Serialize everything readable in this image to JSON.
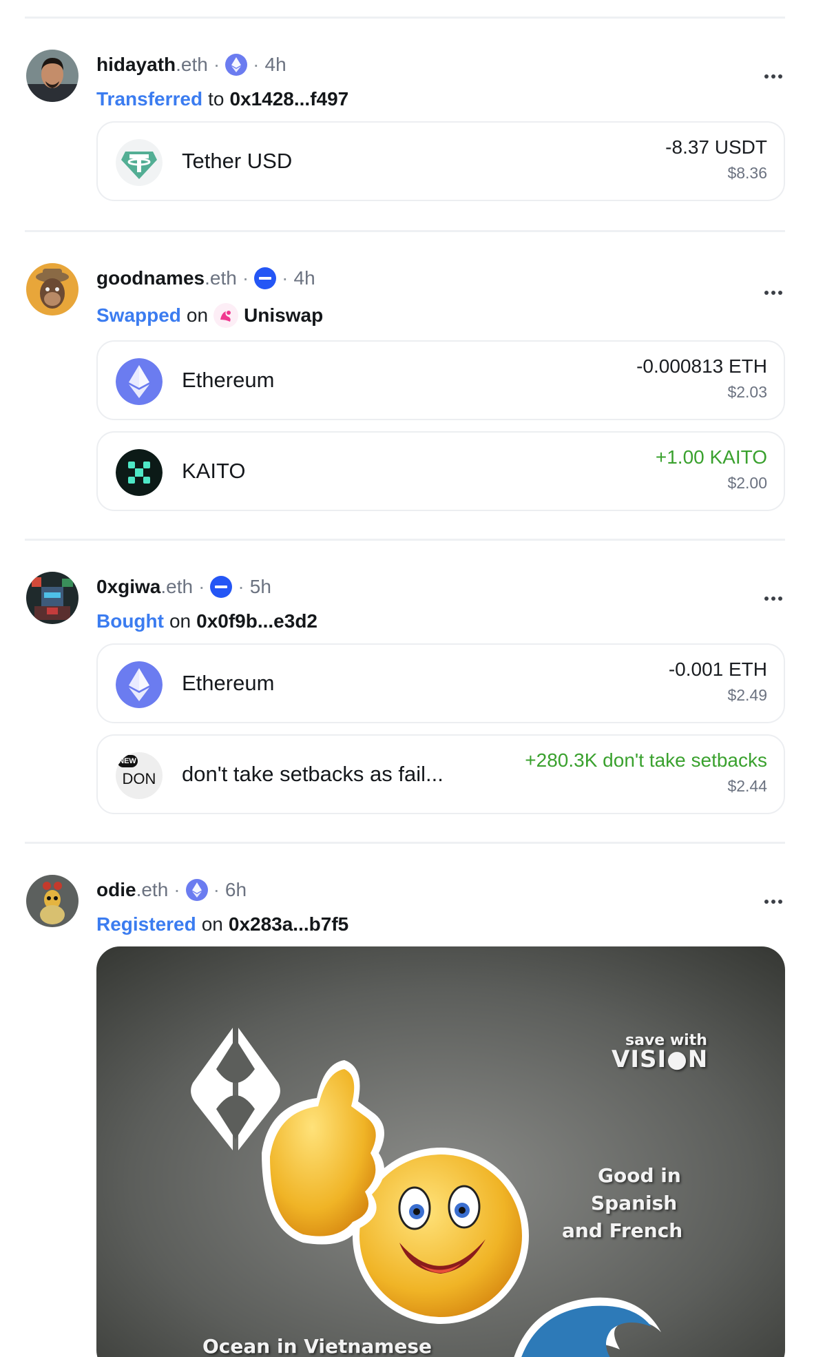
{
  "feed": [
    {
      "user": {
        "name": "hidayath",
        "suffix": ".eth",
        "time": "4h",
        "chain": "ethereum-icon"
      },
      "action": {
        "verb": "Transferred",
        "prep": "to",
        "target": "0x1428...f497"
      },
      "tokens": [
        {
          "icon": "tether-icon",
          "name": "Tether USD",
          "amount": "-8.37 USDT",
          "usd": "$8.36",
          "positive": false
        }
      ]
    },
    {
      "user": {
        "name": "goodnames",
        "suffix": ".eth",
        "time": "4h",
        "chain": "base-icon"
      },
      "action": {
        "verb": "Swapped",
        "prep": "on",
        "protocol_icon": "uniswap-icon",
        "target": "Uniswap"
      },
      "tokens": [
        {
          "icon": "ethereum-icon",
          "name": "Ethereum",
          "amount": "-0.000813 ETH",
          "usd": "$2.03",
          "positive": false
        },
        {
          "icon": "kaito-icon",
          "name": "KAITO",
          "amount": "+1.00 KAITO",
          "usd": "$2.00",
          "positive": true
        }
      ]
    },
    {
      "user": {
        "name": "0xgiwa",
        "suffix": ".eth",
        "time": "5h",
        "chain": "base-icon"
      },
      "action": {
        "verb": "Bought",
        "prep": "on",
        "target": "0x0f9b...e3d2"
      },
      "tokens": [
        {
          "icon": "ethereum-icon",
          "name": "Ethereum",
          "amount": "-0.001 ETH",
          "usd": "$2.49",
          "positive": false
        },
        {
          "icon": "don-token-icon",
          "icon_badge": "NEW",
          "icon_text": "DON",
          "name": "don't take setbacks as fail...",
          "amount": "+280.3K don't take setbacks",
          "usd": "$2.44",
          "positive": true
        }
      ]
    },
    {
      "user": {
        "name": "odie",
        "suffix": ".eth",
        "time": "6h",
        "chain": "ethereum-icon"
      },
      "action": {
        "verb": "Registered",
        "prep": "on",
        "target": "0x283a...b7f5"
      },
      "nft": {
        "brand_small": "save with",
        "brand_large": "VISI●N",
        "tagline_1": "Good in",
        "tagline_2": "Spanish",
        "tagline_3": "and French",
        "caption": "Ocean in Vietnamese"
      }
    }
  ],
  "more_label": "•••",
  "colors": {
    "accent_blue": "#3b7cf0",
    "positive_green": "#3aa12e",
    "muted_gray": "#6b7280",
    "ethereum_purple": "#6b7cf0",
    "base_blue": "#2456f5",
    "tether_green": "#53ae94"
  }
}
